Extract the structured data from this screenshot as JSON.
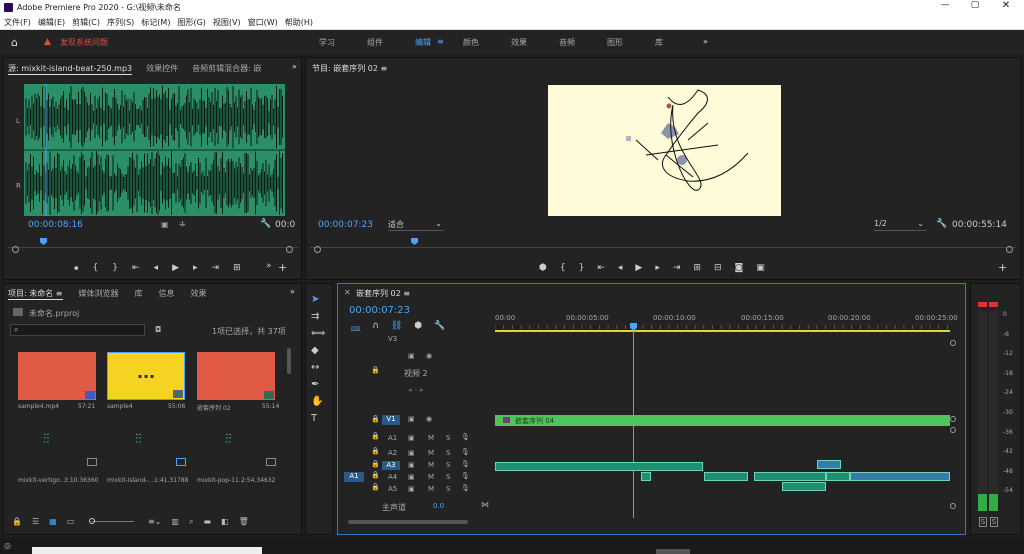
{
  "title": "Adobe Premiere Pro 2020 - G:\\视频\\未命名",
  "menu": [
    "文件(F)",
    "编辑(E)",
    "剪辑(C)",
    "序列(S)",
    "标记(M)",
    "图形(G)",
    "视图(V)",
    "窗口(W)",
    "帮助(H)"
  ],
  "workspace": {
    "report_label": "发现系统问题",
    "tabs": [
      "学习",
      "组件",
      "编辑",
      "颜色",
      "效果",
      "音频",
      "图形",
      "库"
    ],
    "active": "编辑",
    "more": "»"
  },
  "source": {
    "tabs": [
      "源: mixkit-island-beat-250.mp3",
      "效果控件",
      "音频剪辑混合器: 嵌"
    ],
    "timecode": "00:00:08:16",
    "end_time": "00:0",
    "channels": [
      "L",
      "R"
    ],
    "more": "»"
  },
  "program": {
    "title": "节目: 嵌套序列 02",
    "timecode": "00:00:07:23",
    "fit": "适合",
    "quality": "1/2",
    "duration": "00:00:55:14"
  },
  "project": {
    "tabs": [
      "项目: 未命名",
      "媒体浏览器",
      "库",
      "信息",
      "效果"
    ],
    "filename": "未命名.prproj",
    "selection": "1项已选择，共 37项",
    "more": "»",
    "items": [
      {
        "name": "sample4.mp4",
        "dur": "57:21",
        "color": "#e05a45"
      },
      {
        "name": "sample4",
        "dur": "55:06",
        "color": "#f5d322"
      },
      {
        "name": "嵌套序列 02",
        "dur": "55:14",
        "color": "#e05a45"
      },
      {
        "name": "mixkit-vertigo...",
        "dur": "3:10.36360"
      },
      {
        "name": "mixkit-island-...",
        "dur": "1:41.31788"
      },
      {
        "name": "mixkit-pop-11...",
        "dur": "2:54.34632"
      }
    ]
  },
  "timeline": {
    "tab": "嵌套序列 02",
    "timecode": "00:00:07:23",
    "ruler": [
      "00:00",
      "00:00:05:00",
      "00:00:10:00",
      "00:00:15:00",
      "00:00:20:00",
      "00:00:25:00"
    ],
    "tracks": [
      {
        "id": "V3",
        "name": ""
      },
      {
        "id": "V2",
        "name": "视频 2"
      },
      {
        "id": "V1",
        "name": ""
      },
      {
        "id": "A1",
        "name": ""
      },
      {
        "id": "A2",
        "name": ""
      },
      {
        "id": "A3",
        "name": ""
      },
      {
        "id": "A4",
        "name": ""
      },
      {
        "id": "A5",
        "name": ""
      }
    ],
    "src_a1": "A1",
    "mute": "M",
    "solo": "S",
    "master_label": "主声道",
    "master_value": "0.0",
    "v1_clip": "嵌套序列 04"
  },
  "meter": {
    "scale": [
      "0",
      "-6",
      "-12",
      "-18",
      "-24",
      "-30",
      "-36",
      "-42",
      "-48",
      "-54"
    ],
    "solo": [
      "S",
      "S"
    ]
  }
}
